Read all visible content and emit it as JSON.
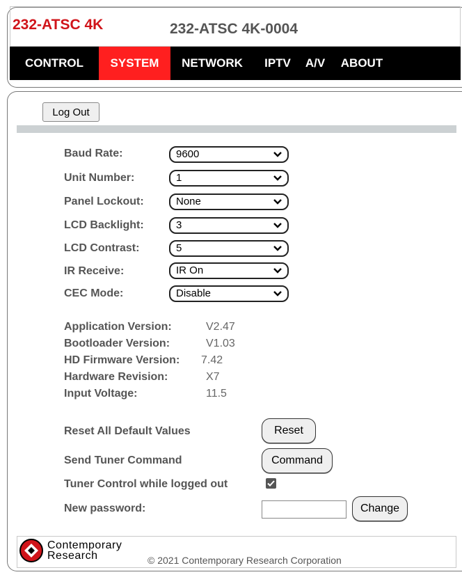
{
  "header": {
    "brand_title": "232-ATSC 4K",
    "device_name": "232-ATSC 4K-0004",
    "nav": [
      {
        "label": "CONTROL",
        "active": false
      },
      {
        "label": "SYSTEM",
        "active": true
      },
      {
        "label": "NETWORK",
        "active": false
      },
      {
        "label": "IPTV",
        "active": false
      },
      {
        "label": "A/V",
        "active": false
      },
      {
        "label": "ABOUT",
        "active": false
      }
    ]
  },
  "main": {
    "logout_label": "Log Out",
    "settings": [
      {
        "label": "Baud Rate:",
        "value": "9600"
      },
      {
        "label": "Unit Number:",
        "value": "1"
      },
      {
        "label": "Panel Lockout:",
        "value": "None"
      },
      {
        "label": "LCD Backlight:",
        "value": "3"
      },
      {
        "label": "LCD Contrast:",
        "value": "5"
      },
      {
        "label": "IR Receive:",
        "value": "IR On"
      },
      {
        "label": "CEC Mode:",
        "value": "Disable"
      }
    ],
    "info": [
      {
        "label": "Application Version:",
        "value": "V2.47"
      },
      {
        "label": "Bootloader Version:",
        "value": "V1.03"
      },
      {
        "label": "HD Firmware Version:",
        "value": "7.42"
      },
      {
        "label": "Hardware Revision:",
        "value": "X7"
      },
      {
        "label": "Input Voltage:",
        "value": "11.5"
      }
    ],
    "actions": {
      "reset_label": "Reset All Default Values",
      "reset_button": "Reset",
      "tuner_label": "Send Tuner Command",
      "tuner_button": "Command",
      "logged_out_label": "Tuner Control while logged out",
      "logged_out_checked": true,
      "password_label": "New password:",
      "password_value": "",
      "change_button": "Change"
    }
  },
  "footer": {
    "logo_word_1": "Contemporary",
    "logo_word_2": "Research",
    "copyright": "© 2021 Contemporary Research Corporation"
  },
  "colors": {
    "brand_red": "#d0141a",
    "nav_active": "#ff1f1f",
    "nav_bg": "#000000",
    "divider": "#ccd1d3"
  }
}
